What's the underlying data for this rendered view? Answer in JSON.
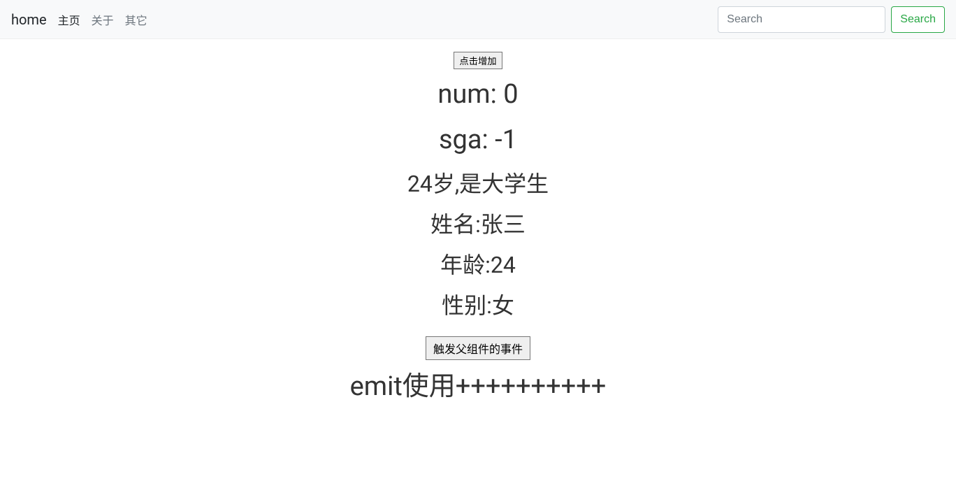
{
  "navbar": {
    "brand": "home",
    "links": [
      {
        "label": "主页",
        "active": true
      },
      {
        "label": "关于",
        "active": false
      },
      {
        "label": "其它",
        "active": false
      }
    ],
    "search_placeholder": "Search",
    "search_button": "Search"
  },
  "main": {
    "increment_button": "点击增加",
    "num_label": "num: 0",
    "sga_label": "sga: -1",
    "student_info": "24岁,是大学生",
    "name_line": "姓名:张三",
    "age_line": "年龄:24",
    "gender_line": "性别:女",
    "trigger_parent_button": "触发父组件的事件",
    "emit_line": "emit使用++++++++++"
  }
}
